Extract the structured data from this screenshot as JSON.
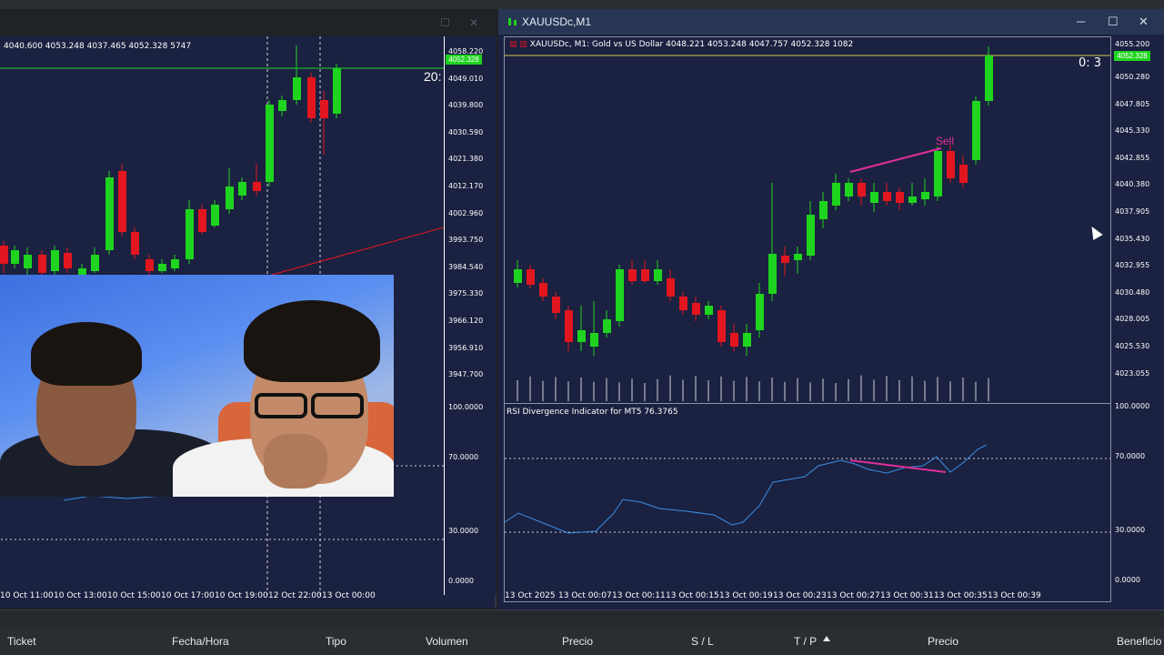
{
  "colors": {
    "chart_bg": "#1b2140",
    "bull": "#1fd41f",
    "bear": "#e2161f",
    "rsi_line": "#3a8fe6",
    "divergence": "#e0309a",
    "price_line": "#1fd41f"
  },
  "left_chart": {
    "ohlc": "4040.600 4053.248 4037.465 4052.328  5747",
    "countdown": "20:",
    "price_ticks": [
      "4058.220",
      "4049.010",
      "4039.800",
      "4030.590",
      "4021.380",
      "4012.170",
      "4002.960",
      "3993.750",
      "3984.540",
      "3975.330",
      "3966.120",
      "3956.910",
      "3947.700"
    ],
    "price_badge": "4052.328",
    "rsi_ticks": [
      "100.0000",
      "70.0000",
      "30.0000",
      "0.0000"
    ],
    "time_labels": [
      "10 Oct 11:00",
      "10 Oct 13:00",
      "10 Oct 15:00",
      "10 Oct 17:00",
      "10 Oct 19:00",
      "12 Oct 22:00",
      "13 Oct 00:00"
    ]
  },
  "right_chart": {
    "window_title": "XAUUSDc,M1",
    "symbol_line": "XAUUSDc, M1:  Gold vs US Dollar",
    "ohlc": "4048.221 4053.248 4047.757 4052.328  1082",
    "countdown": "0: 3",
    "price_badge": "4052.328",
    "top_tick": "4055.200",
    "price_ticks": [
      "4050.280",
      "4047.805",
      "4045.330",
      "4042.855",
      "4040.380",
      "4037.905",
      "4035.430",
      "4032.955",
      "4030.480",
      "4028.005",
      "4025.530",
      "4023.055"
    ],
    "rsi_title": "RSI Divergence Indicator for MT5 76.3765",
    "rsi_ticks": [
      "100.0000",
      "70.0000",
      "30.0000",
      "0.0000"
    ],
    "time_labels": [
      "13 Oct 2025",
      "13 Oct 00:07",
      "13 Oct 00:11",
      "13 Oct 00:15",
      "13 Oct 00:19",
      "13 Oct 00:23",
      "13 Oct 00:27",
      "13 Oct 00:31",
      "13 Oct 00:35",
      "13 Oct 00:39"
    ],
    "signal_label": "Sell"
  },
  "toolbox": {
    "columns": [
      "Ticket",
      "Fecha/Hora",
      "Tipo",
      "Volumen",
      "Precio",
      "S / L",
      "T / P",
      "Precio",
      "Beneficio"
    ]
  },
  "window_buttons": {
    "minimize": "─",
    "maximize": "☐",
    "close": "✕"
  }
}
